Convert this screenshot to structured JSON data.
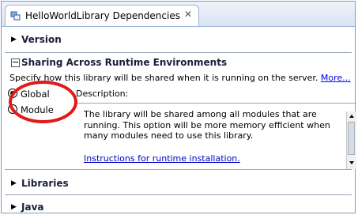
{
  "tab": {
    "title": "HelloWorldLibrary Dependencies",
    "close_symbol": "✕",
    "icon": "library-dependencies-icon"
  },
  "sections": {
    "version": "Version",
    "sharing": "Sharing Across Runtime Environments",
    "libraries": "Libraries",
    "java": "Java"
  },
  "sharing": {
    "description_text": "Specify how this library will be shared when it is running on the server.",
    "more_link": "More...",
    "options": [
      {
        "label": "Global",
        "selected": true
      },
      {
        "label": "Module",
        "selected": false
      }
    ],
    "description_label": "Description:",
    "description_body": "The library will be shared among all modules that are running. This option will be more memory efficient when many modules need to use this library.",
    "instructions_link": "Instructions for runtime installation."
  },
  "colors": {
    "annotation_circle": "#e31818",
    "link": "#0000cc",
    "section_title": "#1b1f3a"
  }
}
